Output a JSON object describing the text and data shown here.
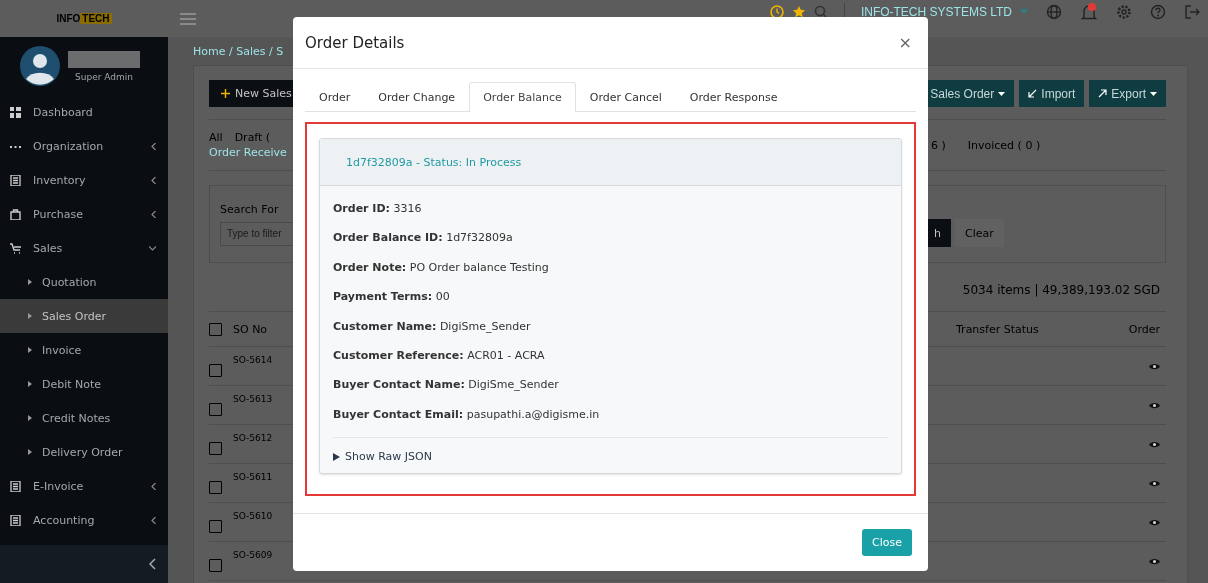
{
  "topbar": {
    "logo": {
      "part_1": "INFO",
      "part_2": "TECH"
    },
    "company": "INFO-TECH SYSTEMS LTD"
  },
  "sidebar": {
    "user": {
      "role": "Super Admin"
    },
    "items": [
      {
        "label": "Dashboard",
        "selected": false
      },
      {
        "label": "Organization",
        "selected": false,
        "expanded": false
      },
      {
        "label": "Inventory",
        "selected": false,
        "expanded": false
      },
      {
        "label": "Purchase",
        "selected": false,
        "expanded": false
      },
      {
        "label": "Sales",
        "selected": false,
        "expanded": true,
        "children": [
          {
            "label": "Quotation",
            "selected": false
          },
          {
            "label": "Sales Order",
            "selected": true
          },
          {
            "label": "Invoice",
            "selected": false
          },
          {
            "label": "Debit Note",
            "selected": false
          },
          {
            "label": "Credit Notes",
            "selected": false
          },
          {
            "label": "Delivery Order",
            "selected": false
          }
        ]
      },
      {
        "label": "E-Invoice",
        "selected": false,
        "expanded": false
      },
      {
        "label": "Accounting",
        "selected": false,
        "expanded": false
      }
    ]
  },
  "page": {
    "breadcrumb": "Home / Sales / S",
    "toolbar": {
      "new_button": "New Sales",
      "dropdown_button": "Sales Order",
      "import_button": "Import",
      "export_button": "Export"
    },
    "status_filters": {
      "left": [
        {
          "label": "All",
          "selected": false
        },
        {
          "label": "Draft (",
          "selected": false
        },
        {
          "label": "Order Receive",
          "selected": true
        }
      ],
      "right": [
        {
          "label": "6 )",
          "selected": false
        },
        {
          "label": "Invoiced ( 0 )",
          "selected": false
        }
      ]
    },
    "search": {
      "label": "Search For",
      "placeholder": "Type to filter",
      "search_button": "h",
      "clear_button": "Clear"
    },
    "summary": "5034 items | 49,389,193.02 SGD",
    "table": {
      "columns": [
        "SO No",
        "Transfer Status",
        "Order"
      ],
      "select_all_checked": false,
      "rows": [
        {
          "so_no": "SO-5614",
          "checked": false
        },
        {
          "so_no": "SO-5613",
          "checked": false
        },
        {
          "so_no": "SO-5612",
          "checked": false
        },
        {
          "so_no": "SO-5611",
          "checked": false
        },
        {
          "so_no": "SO-5610",
          "checked": false
        },
        {
          "so_no": "SO-5609",
          "checked": false
        }
      ]
    }
  },
  "modal": {
    "title": "Order Details",
    "close_glyph": "×",
    "tabs": [
      {
        "label": "Order",
        "selected": false
      },
      {
        "label": "Order Change",
        "selected": false
      },
      {
        "label": "Order Balance",
        "selected": true
      },
      {
        "label": "Order Cancel",
        "selected": false
      },
      {
        "label": "Order Response",
        "selected": false
      }
    ],
    "balance": {
      "header": "1d7f32809a - Status: In Process",
      "fields": [
        "**Order ID:** 3316",
        "**Order Balance ID:** 1d7f32809a",
        "**Order Note:** PO Order balance Testing",
        "**Payment Terms:** 00",
        "**Customer Name:** DigiSme_Sender",
        "**Customer Reference:** ACR01 - ACRA",
        "**Buyer Contact Name:** DigiSme_Sender",
        "**Buyer Contact Email:** pasupathi.a@digisme.in"
      ],
      "raw_json_toggle": {
        "label": "Show Raw JSON",
        "expanded": false
      }
    },
    "close_button": "Close"
  }
}
